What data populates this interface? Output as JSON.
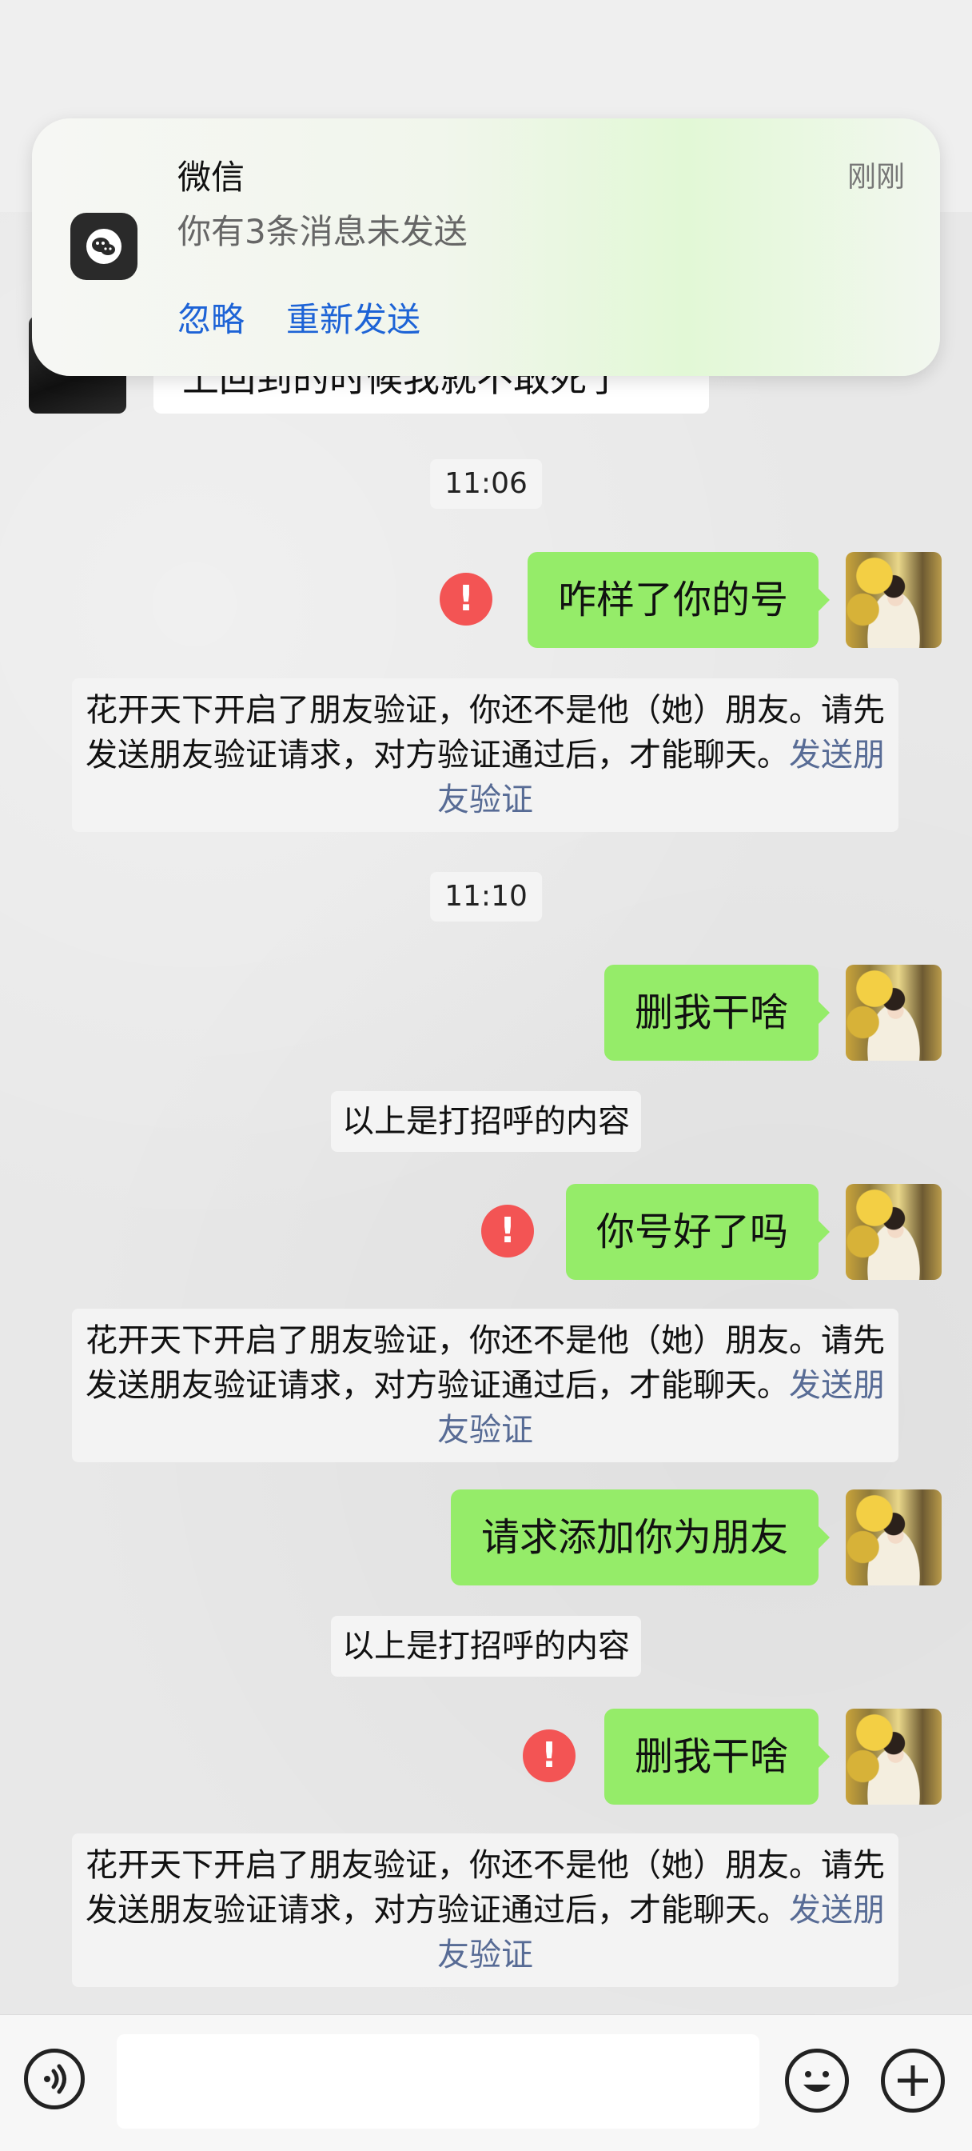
{
  "notification": {
    "app_name": "微信",
    "time": "刚刚",
    "message": "你有3条消息未发送",
    "ignore_label": "忽略",
    "resend_label": "重新发送",
    "app_icon": "wechat-icon"
  },
  "previous_message": {
    "text": "上回到的时候我就不敢死了"
  },
  "messages": {
    "time_1": "11:06",
    "msg_1": "咋样了你的号",
    "note_1_text": "花开天下开启了朋友验证，你还不是他（她）朋友。请先发送朋友验证请求，对方验证通过后，才能聊天。",
    "note_1_link": "发送朋友验证",
    "time_2": "11:10",
    "msg_2": "删我干啥",
    "greeting_1": "以上是打招呼的内容",
    "msg_3": "你号好了吗",
    "note_2_text": "花开天下开启了朋友验证，你还不是他（她）朋友。请先发送朋友验证请求，对方验证通过后，才能聊天。",
    "note_2_link": "发送朋友验证",
    "msg_4": "请求添加你为朋友",
    "greeting_2": "以上是打招呼的内容",
    "msg_5": "删我干啥",
    "note_3_text": "花开天下开启了朋友验证，你还不是他（她）朋友。请先发送朋友验证请求，对方验证通过后，才能聊天。",
    "note_3_link": "发送朋友验证",
    "error_glyph": "!"
  },
  "input_bar": {
    "voice_icon": "voice-icon",
    "emoji_icon": "emoji-icon",
    "plus_icon": "plus-icon",
    "input_value": ""
  },
  "colors": {
    "bubble_out": "#95ec69",
    "error": "#f35454",
    "link": "#576b95",
    "notif_action": "#1d63d6"
  }
}
